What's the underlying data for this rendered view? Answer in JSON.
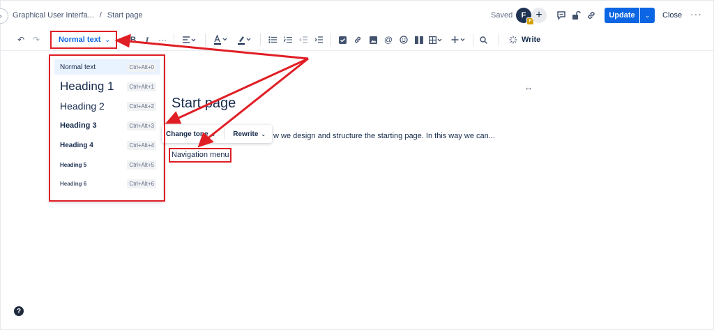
{
  "header": {
    "breadcrumbs": [
      "Graphical User Interfa...",
      "/",
      "Start page"
    ],
    "saved_label": "Saved",
    "avatar_initial": "F",
    "avatar_badge": "F",
    "update_label": "Update",
    "close_label": "Close"
  },
  "toolbar": {
    "text_style_label": "Normal text",
    "write_label": "Write"
  },
  "dropdown": {
    "items": [
      {
        "label": "Normal text",
        "shortcut": "Ctrl+Alt+0"
      },
      {
        "label": "Heading 1",
        "shortcut": "Ctrl+Alt+1"
      },
      {
        "label": "Heading 2",
        "shortcut": "Ctrl+Alt+2"
      },
      {
        "label": "Heading 3",
        "shortcut": "Ctrl+Alt+3"
      },
      {
        "label": "Heading 4",
        "shortcut": "Ctrl+Alt+4"
      },
      {
        "label": "Heading 5",
        "shortcut": "Ctrl+Alt+5"
      },
      {
        "label": "Heading 6",
        "shortcut": "Ctrl+Alt+6"
      }
    ]
  },
  "content": {
    "title": "Start page",
    "ai_change_tone": "Change tone",
    "ai_rewrite": "Rewrite",
    "paragraph": "w we design and structure the starting page. In this way we can...",
    "nav_text": "Navigation menu"
  },
  "help_label": "?",
  "colors": {
    "accent": "#0c66e4",
    "annotation": "#e01e25",
    "text": "#172b4d"
  }
}
